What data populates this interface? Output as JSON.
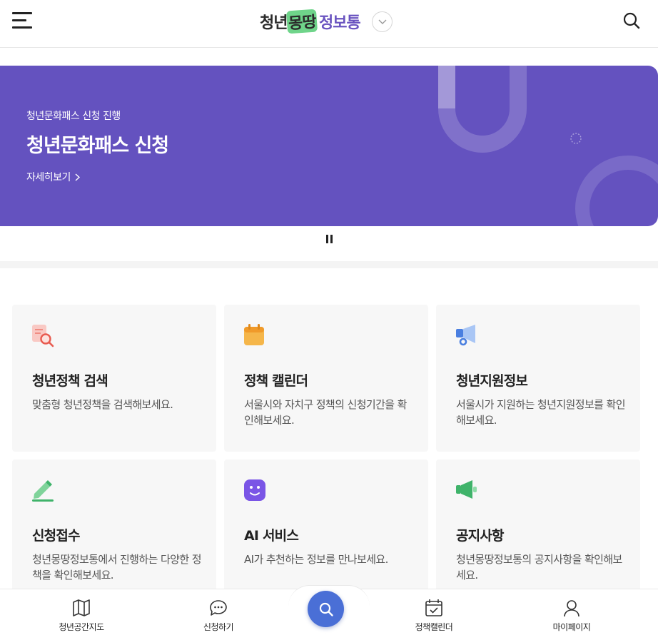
{
  "header": {
    "logo_part1": "청년",
    "logo_part2": "몽땅",
    "logo_part3": "정보통",
    "menu_icon": "hamburger-menu-icon",
    "search_icon": "search-icon",
    "toggle_icon": "chevron-down-icon"
  },
  "banner": {
    "subtitle": "청년문화패스 신청 진행",
    "title": "청년문화패스 신청",
    "link_label": "자세히보기",
    "bg_color": "#6452bf"
  },
  "cards": [
    {
      "title": "청년정책 검색",
      "desc": "맞춤형 청년정책을 검색해보세요.",
      "icon": "document-search-icon"
    },
    {
      "title": "정책 캘린더",
      "desc": "서울시와 자치구 정책의 신청기간을 확인해보세요.",
      "icon": "calendar-icon"
    },
    {
      "title": "청년지원정보",
      "desc": "서울시가 지원하는 청년지원정보를 확인해보세요.",
      "icon": "megaphone-icon"
    },
    {
      "title": "신청접수",
      "desc": "청년몽땅정보통에서 진행하는 다양한 정책을 확인해보세요.",
      "icon": "pencil-icon"
    },
    {
      "title": "AI 서비스",
      "desc": "AI가 추천하는 정보를 만나보세요.",
      "icon": "ai-face-icon"
    },
    {
      "title": "공지사항",
      "desc": "청년몽땅정보통의 공지사항을 확인해보세요.",
      "icon": "announcement-icon"
    }
  ],
  "bottom_nav": {
    "items": [
      {
        "label": "청년공간지도",
        "icon": "map-icon"
      },
      {
        "label": "신청하기",
        "icon": "chat-bubble-icon"
      },
      {
        "label": "정책캘린더",
        "icon": "calendar-check-icon"
      },
      {
        "label": "마이페이지",
        "icon": "user-icon"
      }
    ],
    "fab_icon": "search-icon",
    "fab_color": "#4a6fd6"
  }
}
